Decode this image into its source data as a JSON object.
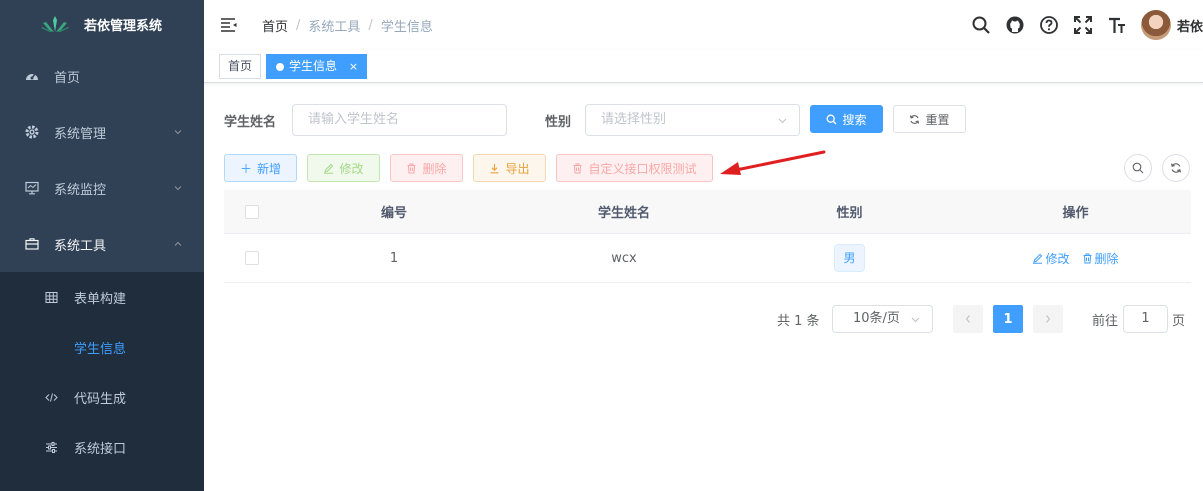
{
  "app": {
    "title": "若依管理系统"
  },
  "sidebar": {
    "items": [
      {
        "label": "首页",
        "icon": "dashboard-icon"
      },
      {
        "label": "系统管理",
        "icon": "gear-icon"
      },
      {
        "label": "系统监控",
        "icon": "monitor-icon"
      },
      {
        "label": "系统工具",
        "icon": "toolbox-icon",
        "open": true
      }
    ],
    "subitems": [
      {
        "label": "表单构建",
        "icon": "grid-icon"
      },
      {
        "label": "学生信息",
        "icon": "none",
        "active": true
      },
      {
        "label": "代码生成",
        "icon": "code-icon"
      },
      {
        "label": "系统接口",
        "icon": "sliders-icon"
      }
    ]
  },
  "navbar": {
    "breadcrumb": [
      "首页",
      "系统工具",
      "学生信息"
    ],
    "separator": "/",
    "user": {
      "name": "若依"
    }
  },
  "tags": [
    {
      "label": "首页"
    },
    {
      "label": "学生信息",
      "close": "×",
      "active": true
    }
  ],
  "search": {
    "name_label": "学生姓名",
    "name_placeholder": "请输入学生姓名",
    "gender_label": "性别",
    "gender_placeholder": "请选择性别",
    "search_button": "搜索",
    "reset_button": "重置"
  },
  "toolbar": {
    "add": "新增",
    "edit": "修改",
    "delete": "删除",
    "export": "导出",
    "custom": "自定义接口权限测试"
  },
  "table": {
    "headers": [
      "编号",
      "学生姓名",
      "性别",
      "操作"
    ],
    "rows": [
      {
        "id": "1",
        "name": "wcx",
        "gender": "男",
        "edit": "修改",
        "delete": "删除"
      }
    ]
  },
  "pagination": {
    "total_text": "共 1 条",
    "page_size": "10条/页",
    "current_page": "1",
    "goto_prefix": "前往",
    "goto_value": "1",
    "goto_suffix": "页"
  },
  "colors": {
    "sidebar_bg": "#304156",
    "submenu_bg": "#1f2d3d",
    "primary": "#409eff",
    "annotation_arrow": "#e02020"
  }
}
